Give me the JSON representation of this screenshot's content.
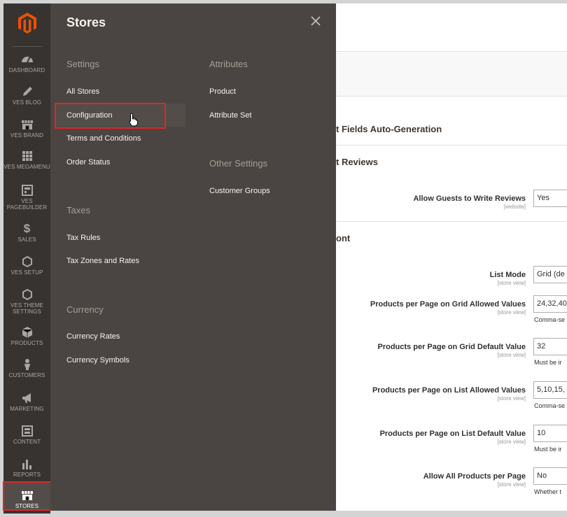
{
  "sidebar": {
    "items": [
      {
        "label": "DASHBOARD",
        "icon": "dashboard-icon"
      },
      {
        "label": "VES BLOG",
        "icon": "pencil-icon"
      },
      {
        "label": "VES BRAND",
        "icon": "store-icon"
      },
      {
        "label": "VES MEGAMENU",
        "icon": "grid-icon"
      },
      {
        "label": "VES PAGEBUILDER",
        "icon": "layout-icon"
      },
      {
        "label": "SALES",
        "icon": "dollar-icon"
      },
      {
        "label": "VES SETUP",
        "icon": "hexagon-icon"
      },
      {
        "label": "VES THEME SETTINGS",
        "icon": "hexagon-icon"
      },
      {
        "label": "PRODUCTS",
        "icon": "cube-icon"
      },
      {
        "label": "CUSTOMERS",
        "icon": "person-icon"
      },
      {
        "label": "MARKETING",
        "icon": "megaphone-icon"
      },
      {
        "label": "CONTENT",
        "icon": "content-icon"
      },
      {
        "label": "REPORTS",
        "icon": "bar-chart-icon"
      },
      {
        "label": "STORES",
        "icon": "store-icon"
      }
    ]
  },
  "flyout": {
    "title": "Stores",
    "settings": {
      "heading": "Settings",
      "links": [
        "All Stores",
        "Configuration",
        "Terms and Conditions",
        "Order Status"
      ]
    },
    "taxes": {
      "heading": "Taxes",
      "links": [
        "Tax Rules",
        "Tax Zones and Rates"
      ]
    },
    "currency": {
      "heading": "Currency",
      "links": [
        "Currency Rates",
        "Currency Symbols"
      ]
    },
    "attributes": {
      "heading": "Attributes",
      "links": [
        "Product",
        "Attribute Set"
      ]
    },
    "other": {
      "heading": "Other Settings",
      "links": [
        "Customer Groups"
      ]
    }
  },
  "main": {
    "sections": [
      {
        "title": "t Fields Auto-Generation"
      },
      {
        "title": "t Reviews"
      },
      {
        "title": "ont"
      }
    ],
    "fields": [
      {
        "label": "Allow Guests to Write Reviews",
        "scope": "[website]",
        "value": "Yes",
        "note": ""
      },
      {
        "label": "List Mode",
        "scope": "[store view]",
        "value": "Grid (de",
        "note": ""
      },
      {
        "label": "Products per Page on Grid Allowed Values",
        "scope": "[store view]",
        "value": "24,32,40",
        "note": "Comma-se"
      },
      {
        "label": "Products per Page on Grid Default Value",
        "scope": "[store view]",
        "value": "32",
        "note": "Must be ir"
      },
      {
        "label": "Products per Page on List Allowed Values",
        "scope": "[store view]",
        "value": "5,10,15,",
        "note": "Comma-se"
      },
      {
        "label": "Products per Page on List Default Value",
        "scope": "[store view]",
        "value": "10",
        "note": "Must be ir"
      },
      {
        "label": "Allow All Products per Page",
        "scope": "[store view]",
        "value": "No",
        "note": "Whether t"
      }
    ]
  },
  "colors": {
    "brand": "#eb5202",
    "highlight": "#e22626",
    "sidebar_bg": "#373330",
    "flyout_bg": "#4a4542"
  }
}
